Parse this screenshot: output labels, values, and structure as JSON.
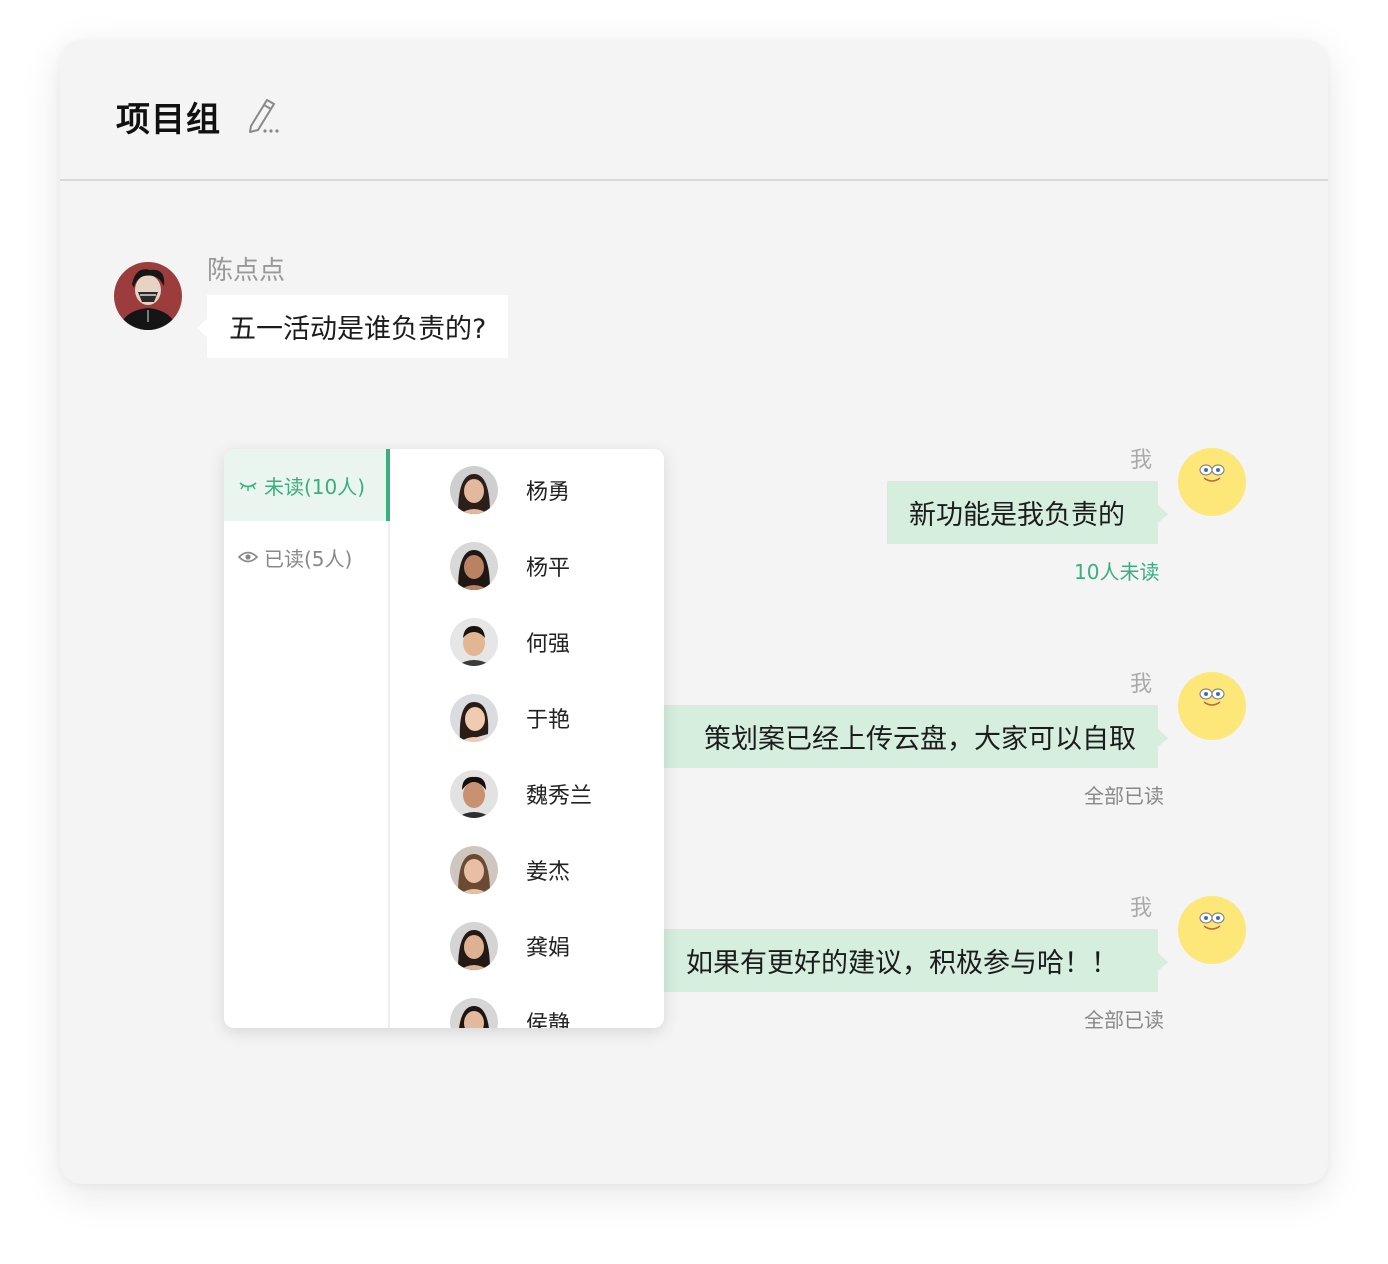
{
  "header": {
    "title": "项目组",
    "edit_icon": "edit-pencil-icon"
  },
  "messages": [
    {
      "sender": "陈点点",
      "text": "五一活动是谁负责的?"
    },
    {
      "sender": "我",
      "text": "新功能是我负责的",
      "status": "10人未读",
      "status_type": "unread"
    },
    {
      "sender": "我",
      "text": "策划案已经上传云盘，大家可以自取",
      "status": "全部已读",
      "status_type": "read"
    },
    {
      "sender": "我",
      "text": "如果有更好的建议，积极参与哈！！",
      "status": "全部已读",
      "status_type": "read"
    }
  ],
  "popup": {
    "tabs": [
      {
        "label": "未读(10人)",
        "icon": "closed-eye-icon",
        "active": true
      },
      {
        "label": "已读(5人)",
        "icon": "eye-icon",
        "active": false
      }
    ],
    "members": [
      "杨勇",
      "杨平",
      "何强",
      "于艳",
      "魏秀兰",
      "姜杰",
      "龚娟",
      "侯静"
    ]
  },
  "colors": {
    "accent": "#3aae7f",
    "bubble_out": "#d5eedd",
    "bubble_in": "#ffffff",
    "background": "#f4f4f4"
  }
}
